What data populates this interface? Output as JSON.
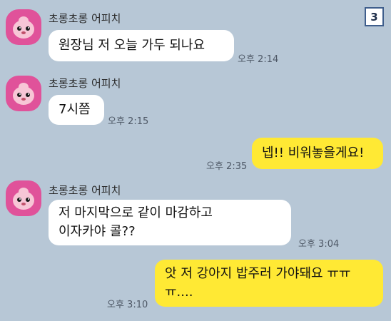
{
  "page_indicator": "3",
  "colors": {
    "background": "#b7c7d6",
    "incoming_bubble": "#ffffff",
    "outgoing_bubble": "#ffe934",
    "avatar": "#e0529a"
  },
  "messages": [
    {
      "direction": "incoming",
      "sender": "초롱초롱 어피치",
      "text": "원장님 저 오늘 가두 되나요",
      "time": "오후 2:14"
    },
    {
      "direction": "incoming",
      "sender": "초롱초롱 어피치",
      "text": "7시쯤",
      "time": "오후 2:15"
    },
    {
      "direction": "outgoing",
      "text": "넵!! 비워놓을게요!",
      "time": "오후 2:35"
    },
    {
      "direction": "incoming",
      "sender": "초롱초롱 어피치",
      "text": "저 마지막으로 같이 마감하고\n이자카야 콜??",
      "time": "오후 3:04"
    },
    {
      "direction": "outgoing",
      "text": "앗 저 강아지 밥주러 가야돼요 ㅠㅠ\nㅠ....",
      "time": "오후 3:10"
    }
  ]
}
